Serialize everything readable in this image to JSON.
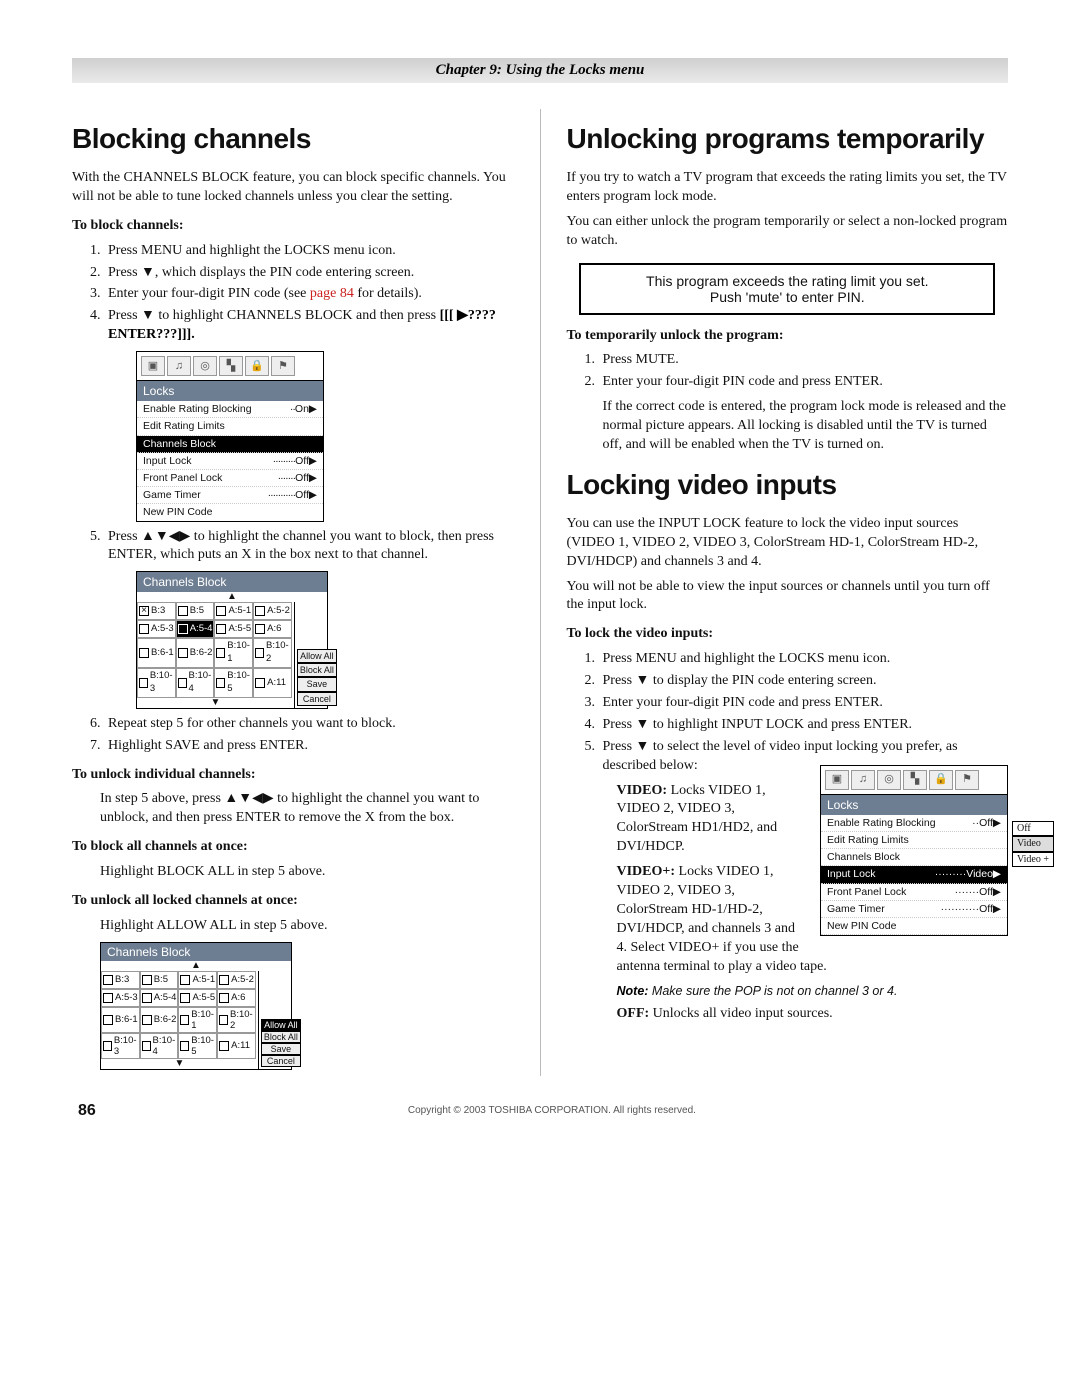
{
  "chapter_banner": "Chapter 9: Using the Locks menu",
  "page_number": "86",
  "copyright": "Copyright © 2003 TOSHIBA CORPORATION. All rights reserved.",
  "left": {
    "h1": "Blocking channels",
    "intro": "With the CHANNELS BLOCK feature, you can block specific channels. You will not be able to tune locked channels unless you clear the setting.",
    "sub_block": "To block channels:",
    "steps_block": {
      "s1": "Press MENU and highlight the LOCKS menu icon.",
      "s2": "Press ▼, which displays the PIN code entering screen.",
      "s3_a": "Enter your four-digit PIN code (see ",
      "s3_link": "page 84",
      "s3_b": " for details).",
      "s4_a": "Press ▼ to highlight CHANNELS BLOCK and then press ",
      "s4_b": "[[[ ▶???? ENTER???]]].",
      "s5": "Press ▲▼◀▶ to highlight the channel you want to block, then press ENTER, which puts an X in the box next to that channel.",
      "s6": "Repeat step 5 for other channels you want to block.",
      "s7": "Highlight SAVE and press ENTER."
    },
    "sub_unlock_one": "To unlock individual channels:",
    "unlock_one_body": "In step 5 above, press ▲▼◀▶ to highlight the channel you want to unblock, and then press ENTER to remove the X from the box.",
    "sub_block_all": "To block all channels at once:",
    "block_all_body": "Highlight BLOCK ALL in step 5 above.",
    "sub_unlock_all": "To unlock all locked channels at once:",
    "unlock_all_body": "Highlight ALLOW ALL in step 5 above.",
    "osd_locks": {
      "title": "Locks",
      "rows": [
        {
          "label": "Enable Rating Blocking",
          "value": "On▶"
        },
        {
          "label": "Edit Rating Limits",
          "value": ""
        },
        {
          "label": "Channels Block",
          "value": "",
          "selected": true
        },
        {
          "label": "Input Lock",
          "value": "Off▶"
        },
        {
          "label": "Front Panel Lock",
          "value": "Off▶"
        },
        {
          "label": "Game Timer",
          "value": "Off▶"
        },
        {
          "label": "New PIN Code",
          "value": ""
        }
      ]
    },
    "chan_block_title": "Channels Block",
    "chan_row1": [
      "B:3",
      "B:5",
      "A:5-1",
      "A:5-2",
      ""
    ],
    "chan_row2": [
      "A:5-3",
      "A:5-4",
      "A:5-5",
      "A:6",
      ""
    ],
    "chan_row3": [
      "B:6-1",
      "B:6-2",
      "B:10-1",
      "B:10-2",
      ""
    ],
    "chan_row4": [
      "B:10-3",
      "B:10-4",
      "B:10-5",
      "A:11",
      ""
    ],
    "side_allow": "Allow All",
    "side_block": "Block All",
    "side_save": "Save",
    "side_cancel": "Cancel"
  },
  "right": {
    "h1": "Unlocking programs temporarily",
    "intro1": "If you try to watch a TV program that exceeds the rating limits you set, the TV enters program lock mode.",
    "intro2": "You can either unlock the program temporarily or select a non-locked program to watch.",
    "dialog1": "This program exceeds the rating limit you set.",
    "dialog2": "Push 'mute' to enter PIN.",
    "sub_temp": "To temporarily unlock the program:",
    "steps_temp": {
      "s1": "Press MUTE.",
      "s2": "Enter your four-digit PIN code and press ENTER.",
      "s2_after": "If the correct code is entered, the program lock mode is released and the normal picture appears. All locking is disabled until the TV is turned off, and will be enabled when the TV is turned on."
    },
    "h2": "Locking video inputs",
    "body1": "You can use the INPUT LOCK feature to lock the video input sources (VIDEO 1, VIDEO 2, VIDEO 3, ColorStream HD-1, ColorStream HD-2, DVI/HDCP) and channels 3 and 4.",
    "body2": "You will not be able to view the input sources or channels until you turn off the input lock.",
    "sub_lock": "To lock the video inputs:",
    "steps_lock": {
      "s1": "Press MENU and highlight the LOCKS menu icon.",
      "s2": "Press ▼ to display the PIN code entering screen.",
      "s3": "Enter your four-digit PIN code and press ENTER.",
      "s4": "Press ▼ to highlight INPUT LOCK and press ENTER.",
      "s5": "Press ▼ to select the level of video input locking you prefer, as described below:"
    },
    "video_label": "VIDEO:",
    "video_body": " Locks VIDEO 1, VIDEO 2, VIDEO 3, ColorStream HD1/HD2, and DVI/HDCP.",
    "videoplus_label": "VIDEO+:",
    "videoplus_body": " Locks VIDEO 1, VIDEO 2, VIDEO 3, ColorStream HD-1/HD-2, DVI/HDCP, and channels 3 and 4. Select VIDEO+ if you use the antenna terminal to play a video tape.",
    "note_label": "Note:",
    "note_body": " Make sure the POP is not on channel 3 or 4.",
    "off_label": "OFF:",
    "off_body": " Unlocks all video input sources.",
    "osd_locks2": {
      "title": "Locks",
      "rows": [
        {
          "label": "Enable Rating Blocking",
          "value": "Off▶"
        },
        {
          "label": "Edit Rating Limits",
          "value": ""
        },
        {
          "label": "Channels Block",
          "value": ""
        },
        {
          "label": "Input Lock",
          "value": "Video▶",
          "selected": true
        },
        {
          "label": "Front Panel Lock",
          "value": "Off▶"
        },
        {
          "label": "Game Timer",
          "value": "Off▶"
        },
        {
          "label": "New PIN Code",
          "value": ""
        }
      ],
      "fly": [
        "Off",
        "Video",
        "Video +"
      ]
    }
  }
}
